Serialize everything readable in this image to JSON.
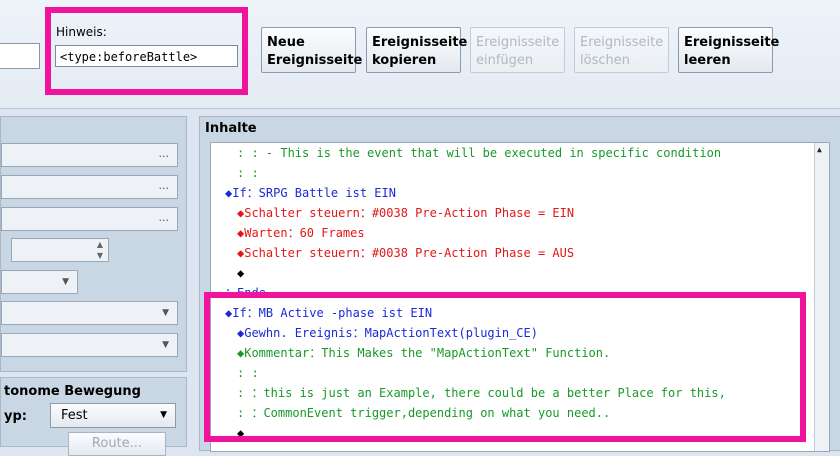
{
  "header": {
    "hint_label": "Hinweis:",
    "hint_value": "<type:beforeBattle>",
    "buttons": [
      {
        "label": "Neue\nEreignisseite",
        "enabled": true
      },
      {
        "label": "Ereignisseite\nkopieren",
        "enabled": true
      },
      {
        "label": "Ereignisseite\neinfügen",
        "enabled": false
      },
      {
        "label": "Ereignisseite\nlöschen",
        "enabled": false
      },
      {
        "label": "Ereignisseite\nleeren",
        "enabled": true
      }
    ]
  },
  "left": {
    "ellipsis": "...",
    "spin_up": "▲",
    "spin_down": "▼",
    "combo_arrow": "▼"
  },
  "autonomous": {
    "title": "tonome Bewegung",
    "type_label": "yp:",
    "type_value": "Fest",
    "route_label": "Route..."
  },
  "contents": {
    "title": "Inhalte",
    "lines": [
      {
        "text": ":          : - This is the event that will be executed in specific condition",
        "color": "green",
        "indent": 1
      },
      {
        "text": ":          :",
        "color": "green",
        "indent": 1
      },
      {
        "text": "◆If：SRPG Battle ist EIN",
        "color": "blue",
        "indent": 0
      },
      {
        "text": "◆Schalter steuern：#0038 Pre-Action Phase = EIN",
        "color": "red",
        "indent": 1
      },
      {
        "text": "◆Warten：60 Frames",
        "color": "red",
        "indent": 1
      },
      {
        "text": "◆Schalter steuern：#0038 Pre-Action Phase = AUS",
        "color": "red",
        "indent": 1
      },
      {
        "text": "◆",
        "color": "black",
        "indent": 1
      },
      {
        "text": "：Ende",
        "color": "blue",
        "indent": 0
      },
      {
        "text": "◆If：MB Active -phase ist EIN",
        "color": "blue",
        "indent": 0
      },
      {
        "text": "◆Gewhn. Ereignis：MapActionText(plugin_CE)",
        "color": "blue",
        "indent": 1
      },
      {
        "text": "◆Kommentar：This Makes the \"MapActionText\" Function.",
        "color": "green",
        "indent": 1
      },
      {
        "text": ":          :",
        "color": "green",
        "indent": 1
      },
      {
        "text": ":          ：this is just an Example, there could be a better Place for this,",
        "color": "green",
        "indent": 1
      },
      {
        "text": ":          ：CommonEvent trigger,depending on what you need..",
        "color": "green",
        "indent": 1
      },
      {
        "text": "◆",
        "color": "black",
        "indent": 1
      }
    ]
  }
}
